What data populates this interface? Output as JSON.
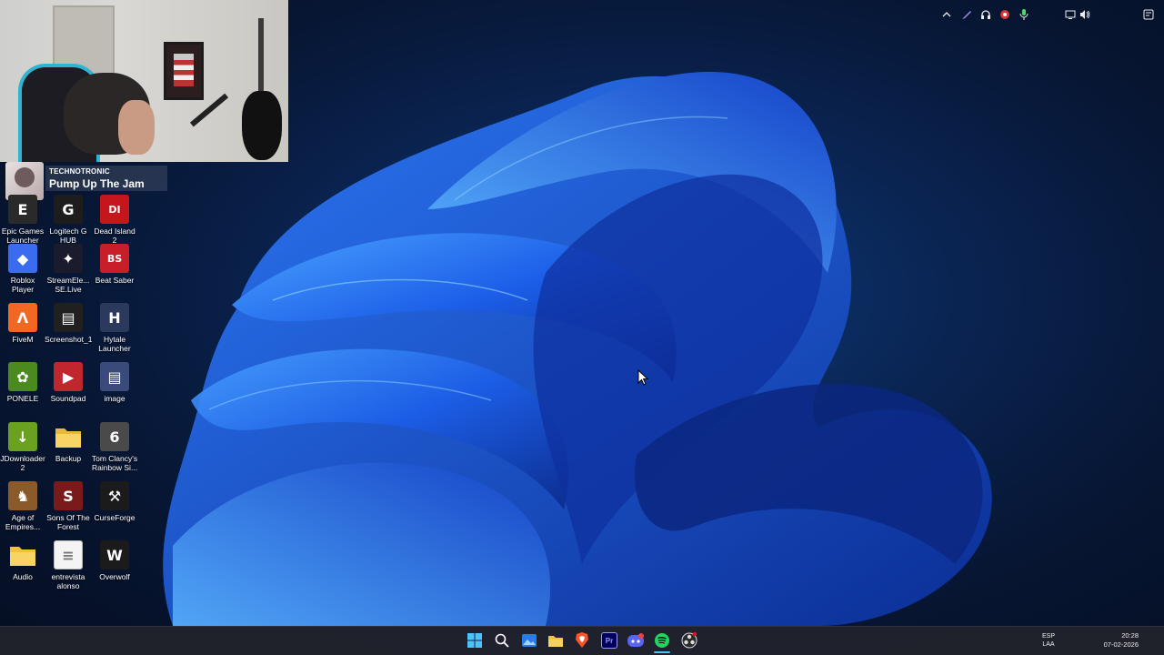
{
  "overlay": {
    "now_playing": {
      "artist": "TECHNOTRONIC",
      "track": "Pump Up The Jam"
    }
  },
  "desktop": {
    "icons": [
      {
        "label": "Epic Games Launcher",
        "icon": "epic-games-icon",
        "color": "#2a2a2a"
      },
      {
        "label": "Logitech G HUB",
        "icon": "logitech-icon",
        "color": "#1d1d1d"
      },
      {
        "label": "Dead Island 2",
        "icon": "dead-island-icon",
        "color": "#c4161c"
      },
      {
        "label": "Roblox Player",
        "icon": "roblox-icon",
        "color": "#3b6cf0"
      },
      {
        "label": "StreamEle... SE.Live",
        "icon": "streamelements-icon",
        "color": "#1b1b2e"
      },
      {
        "label": "Beat Saber",
        "icon": "beat-saber-icon",
        "color": "#c81e2a"
      },
      {
        "label": "FiveM",
        "icon": "fivem-icon",
        "color": "#f26722"
      },
      {
        "label": "Screenshot_1",
        "icon": "image-file-icon",
        "color": "#202020"
      },
      {
        "label": "Hytale Launcher",
        "icon": "hytale-icon",
        "color": "#2b3a5c"
      },
      {
        "label": "PONELE",
        "icon": "fl-studio-icon",
        "color": "#4a8a1e"
      },
      {
        "label": "Soundpad",
        "icon": "soundpad-icon",
        "color": "#c0262e"
      },
      {
        "label": "image",
        "icon": "image-file-icon",
        "color": "#3a4a7a"
      },
      {
        "label": "JDownloader 2",
        "icon": "jdownloader-icon",
        "color": "#6aa121"
      },
      {
        "label": "Backup",
        "icon": "folder-icon",
        "color": "#e8b83a"
      },
      {
        "label": "Tom Clancy's Rainbow Si...",
        "icon": "rainbow-six-icon",
        "color": "#4a4a4a"
      },
      {
        "label": "Age of Empires...",
        "icon": "age-of-empires-icon",
        "color": "#8a5a2a"
      },
      {
        "label": "Sons Of The Forest",
        "icon": "sons-of-the-forest-icon",
        "color": "#7a1a1a"
      },
      {
        "label": "CurseForge",
        "icon": "curseforge-icon",
        "color": "#1b1b1b"
      },
      {
        "label": "Audio",
        "icon": "folder-icon",
        "color": "#f2c23c"
      },
      {
        "label": "entrevista alonso",
        "icon": "text-file-icon",
        "color": "#f4f4f4"
      },
      {
        "label": "Overwolf",
        "icon": "overwolf-icon",
        "color": "#1b1b1b"
      }
    ]
  },
  "taskbar": {
    "apps": [
      {
        "name": "Start",
        "icon": "windows-start-icon"
      },
      {
        "name": "Search",
        "icon": "search-icon"
      },
      {
        "name": "Photos",
        "icon": "photos-icon"
      },
      {
        "name": "File Explorer",
        "icon": "folder-icon"
      },
      {
        "name": "Brave",
        "icon": "brave-icon"
      },
      {
        "name": "Premiere Pro",
        "icon": "premiere-pro-icon",
        "text": "Pr"
      },
      {
        "name": "Discord",
        "icon": "discord-icon"
      },
      {
        "name": "Spotify",
        "icon": "spotify-icon"
      },
      {
        "name": "OBS",
        "icon": "obs-icon"
      }
    ],
    "tray": {
      "language_line1": "ESP",
      "language_line2": "LAA",
      "time": "20:28",
      "date": "07-02-2026"
    }
  }
}
